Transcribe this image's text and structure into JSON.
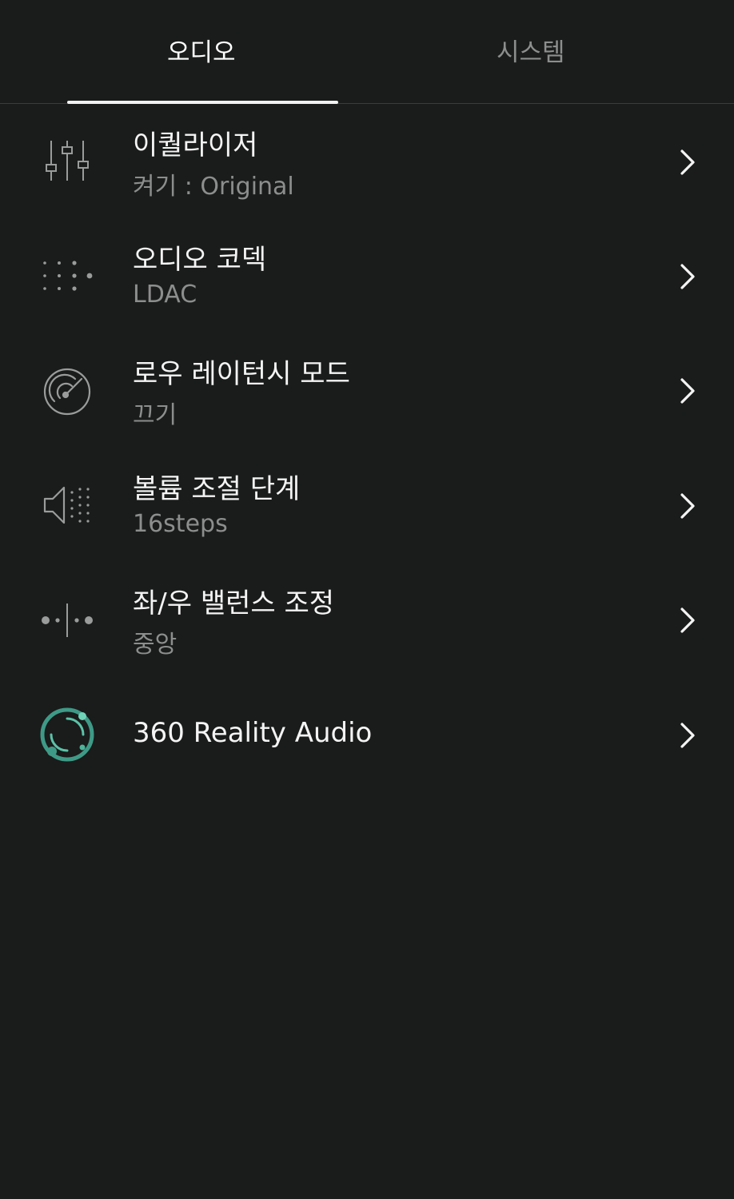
{
  "tabs": [
    {
      "label": "오디오",
      "active": true
    },
    {
      "label": "시스템",
      "active": false
    }
  ],
  "items": [
    {
      "title": "이퀄라이저",
      "subtitle": "켜기 : Original",
      "icon": "equalizer-icon"
    },
    {
      "title": "오디오 코덱",
      "subtitle": "LDAC",
      "icon": "codec-dots-icon"
    },
    {
      "title": "로우 레이턴시 모드",
      "subtitle": "끄기",
      "icon": "gauge-icon"
    },
    {
      "title": "볼륨 조절 단계",
      "subtitle": "16steps",
      "icon": "speaker-volume-icon"
    },
    {
      "title": "좌/우 밸런스 조정",
      "subtitle": "중앙",
      "icon": "balance-icon"
    },
    {
      "title": "360 Reality Audio",
      "icon": "reality-audio-icon"
    }
  ],
  "colors": {
    "background": "#1a1b1b",
    "text_primary": "#f4f4f4",
    "text_secondary": "#8c8d8d",
    "accent_teal": "#3e9a86"
  }
}
